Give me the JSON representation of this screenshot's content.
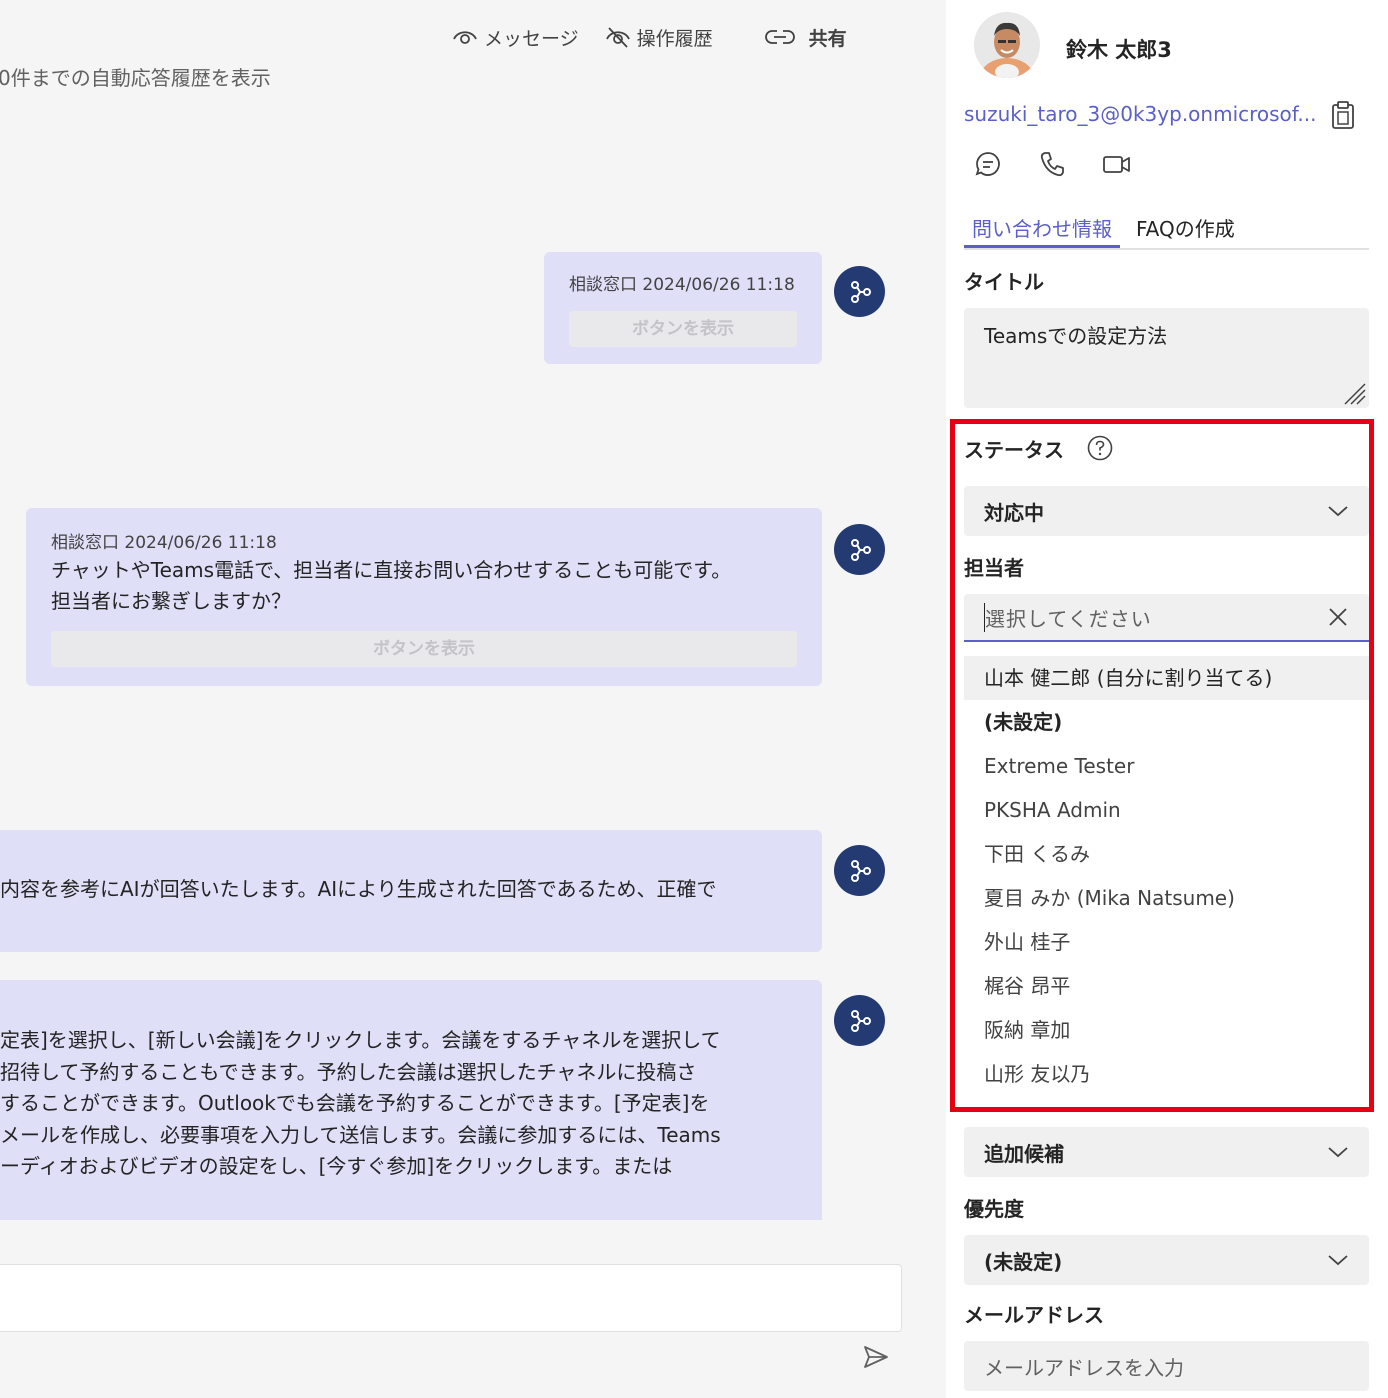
{
  "toolbar": {
    "message_label": "メッセージ",
    "history_label": "操作履歴",
    "share_label": "共有"
  },
  "chat": {
    "history_link": "0件までの自動応答履歴を表示",
    "messages": [
      {
        "meta": "相談窓口 2024/06/26 11:18",
        "button_label": "ボタンを表示"
      },
      {
        "meta": "相談窓口 2024/06/26 11:18",
        "lines": [
          "チャットやTeams電話で、担当者に直接お問い合わせすることも可能です。",
          "担当者にお繋ぎしますか？"
        ],
        "button_label": "ボタンを表示"
      },
      {
        "lines": [
          "内容を参考にAIが回答いたします。AIにより生成された回答であるため、正確で"
        ]
      },
      {
        "lines": [
          "定表]を選択し、[新しい会議]をクリックします。会議をするチャネルを選択して",
          "招待して予約することもできます。予約した会議は選択したチャネルに投稿さ",
          "することができます。Outlookでも会議を予約することができます。[予定表]を",
          "メールを作成し、必要事項を入力して送信します。会議に参加するには、Teams",
          "ーディオおよびビデオの設定をし、[今すぐ参加]をクリックします。または"
        ]
      }
    ]
  },
  "profile": {
    "name": "鈴木 太郎3",
    "email": "suzuki_taro_3@0k3yp.onmicrosof..."
  },
  "tabs": [
    {
      "label": "問い合わせ情報",
      "active": true
    },
    {
      "label": "FAQの作成",
      "active": false
    }
  ],
  "form": {
    "title_label": "タイトル",
    "title_value": "Teamsでの設定方法",
    "status_label": "ステータス",
    "status_value": "対応中",
    "assignee_label": "担当者",
    "assignee_placeholder": "選択してください",
    "assignee_options": [
      "山本 健二郎 (自分に割り当てる)",
      "(未設定)",
      "Extreme Tester",
      "PKSHA Admin",
      "下田 くるみ",
      "夏目 みか (Mika Natsume)",
      "外山 桂子",
      "梶谷 昂平",
      "阪納 章加",
      "山形 友以乃"
    ],
    "extra_candidates_label": "追加候補",
    "priority_label": "優先度",
    "priority_value": "(未設定)",
    "mail_label": "メールアドレス",
    "mail_placeholder": "メールアドレスを入力"
  },
  "colors": {
    "accent": "#5b5fc7",
    "bubble": "#dfe0f8",
    "bot_avatar": "#243a73",
    "highlight": "#e60012"
  }
}
